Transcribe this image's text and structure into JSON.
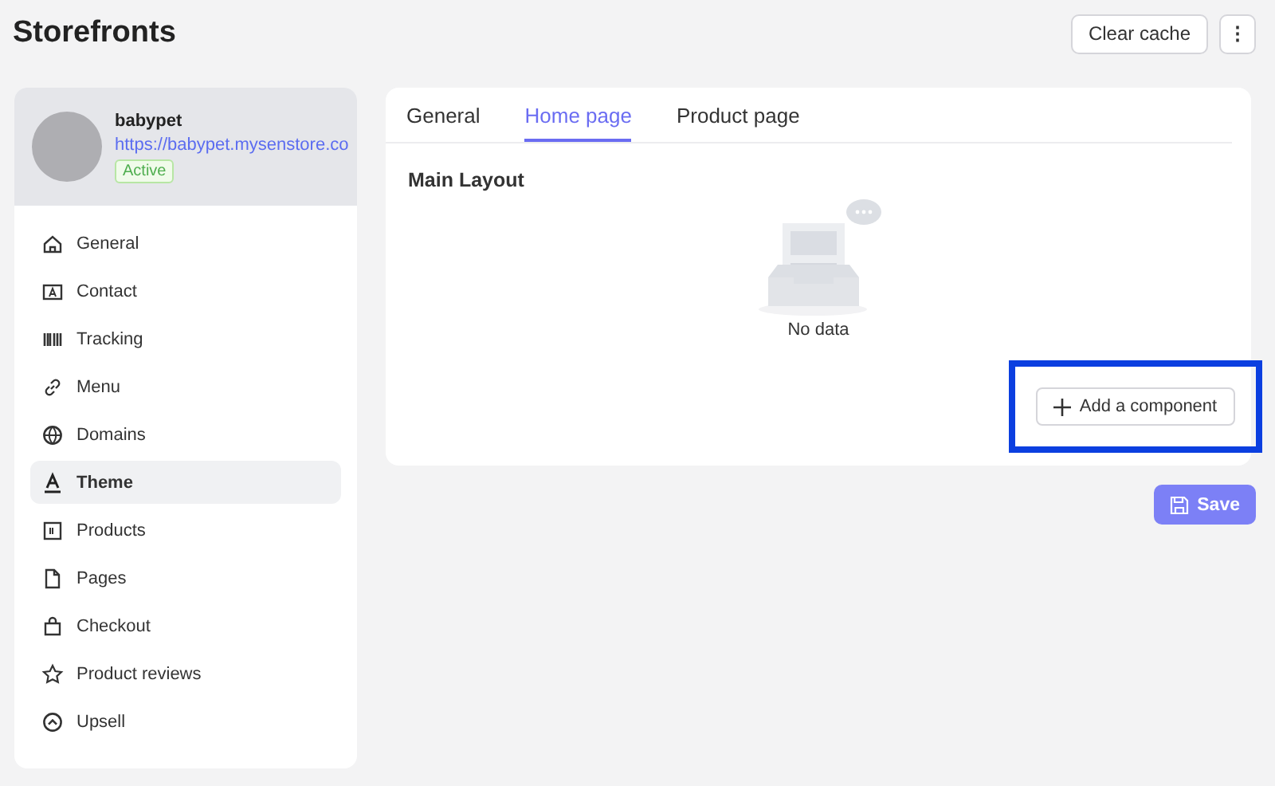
{
  "page_title": "Storefronts",
  "header_buttons": [
    "Clear cache",
    "⋮"
  ],
  "store": {
    "name": "babypet",
    "url": "https://babypet.mysenstore.co",
    "status": "Active"
  },
  "sidebar": {
    "items": [
      {
        "label": "General",
        "selected": false
      },
      {
        "label": "Contact",
        "selected": false
      },
      {
        "label": "Tracking",
        "selected": false
      },
      {
        "label": "Menu",
        "selected": false
      },
      {
        "label": "Domains",
        "selected": false
      },
      {
        "label": "Theme",
        "selected": true
      },
      {
        "label": "Products",
        "selected": false
      },
      {
        "label": "Pages",
        "selected": false
      },
      {
        "label": "Checkout",
        "selected": false
      },
      {
        "label": "Product reviews",
        "selected": false
      },
      {
        "label": "Upsell",
        "selected": false
      }
    ]
  },
  "tabs": [
    {
      "label": "General",
      "selected": false
    },
    {
      "label": "Home page",
      "selected": true
    },
    {
      "label": "Product page",
      "selected": false
    }
  ],
  "section_title": "Main Layout",
  "empty_state": "No data",
  "add_button": "Add a component",
  "save_button": "Save"
}
